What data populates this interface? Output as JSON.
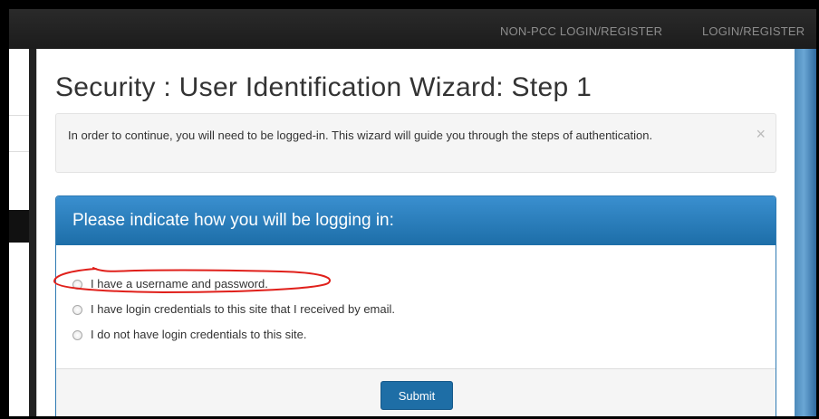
{
  "navbar": {
    "links": [
      "NON-PCC LOGIN/REGISTER",
      "LOGIN/REGISTER"
    ]
  },
  "page": {
    "title": "Security : User Identification Wizard: Step 1"
  },
  "alert": {
    "text": "In order to continue, you will need to be logged-in. This wizard will guide you through the steps of authentication.",
    "close_glyph": "×"
  },
  "panel": {
    "title": "Please indicate how you will be logging in:",
    "options": [
      {
        "label": "I have a username and password.",
        "selected": false
      },
      {
        "label": "I have login credentials to this site that I received by email.",
        "selected": false
      },
      {
        "label": "I do not have login credentials to this site.",
        "selected": false
      }
    ],
    "submit_label": "Submit"
  },
  "annotation": {
    "color": "#e0201b"
  },
  "colors": {
    "primary": "#1e6ea6",
    "navbar": "#222222",
    "alert_bg": "#f5f5f5"
  }
}
